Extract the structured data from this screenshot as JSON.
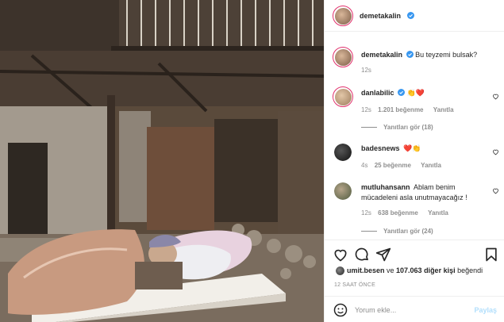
{
  "post": {
    "author": "demetakalin",
    "caption": "Bu teyzemi bulsak?",
    "caption_age": "12s",
    "likes_first": "umit.besen",
    "likes_mid": " ve ",
    "likes_count": "107.063 diğer kişi",
    "likes_tail": " beğendi",
    "posted": "12 SAAT ÖNCE"
  },
  "comments": [
    {
      "user": "danlabilic",
      "text": "👏❤️",
      "age": "12s",
      "likes": "1.201 beğenme",
      "reply": "Yanıtla",
      "view_replies": "Yanıtları gör (18)"
    },
    {
      "user": "badesnews",
      "text": "❤️👏",
      "age": "4s",
      "likes": "25 beğenme",
      "reply": "Yanıtla"
    },
    {
      "user": "mutluhansann",
      "text": "Ablam benim mücadeleni asla unutmayacağız !",
      "age": "12s",
      "likes": "638 beğenme",
      "reply": "Yanıtla",
      "view_replies": "Yanıtları gör (24)"
    }
  ],
  "comment_input": {
    "placeholder": "Yorum ekle...",
    "post_label": "Paylaş"
  },
  "icons": {
    "like": "heart-icon",
    "comment": "comment-icon",
    "share": "send-icon",
    "save": "bookmark-icon",
    "emoji": "smile-icon",
    "verified": "verified-badge-icon"
  },
  "colors": {
    "verified": "#3897f0",
    "text": "#262626",
    "muted": "#8e8e8e",
    "post_disabled": "#b2dffc",
    "story_ring": "#e1306c"
  }
}
